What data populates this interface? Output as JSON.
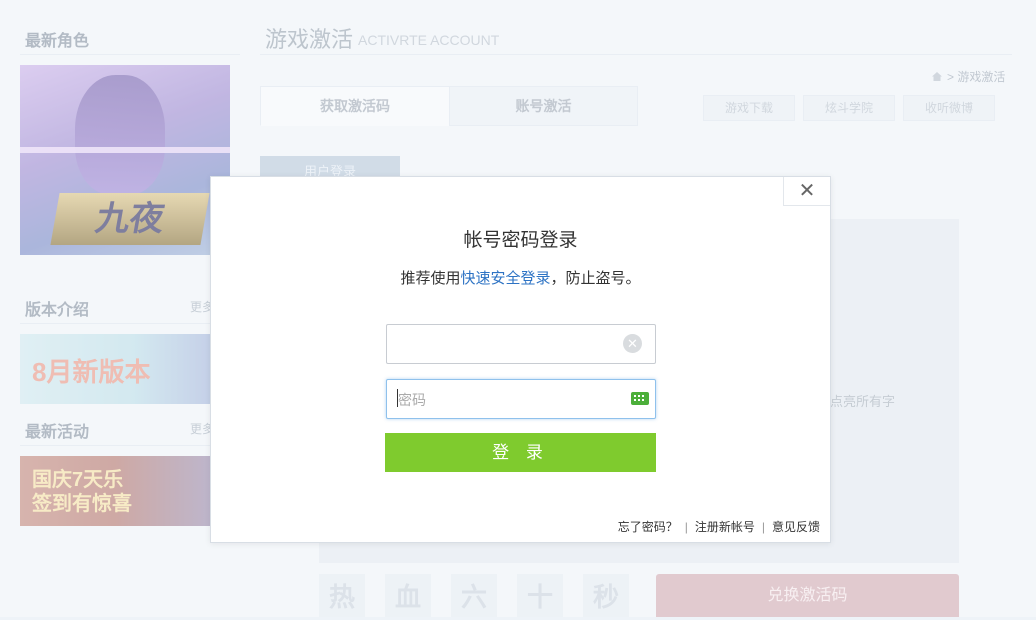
{
  "sidebar": {
    "section1": {
      "title": "最新角色"
    },
    "hero_logo_text": "九夜",
    "section2": {
      "title": "版本介绍",
      "more": "更多"
    },
    "banner1_text": "8月新版本",
    "section3": {
      "title": "最新活动",
      "more": "更多"
    },
    "banner2_text": "国庆7天乐\n签到有惊喜"
  },
  "header": {
    "title": "游戏激活",
    "subtitle": "ACTIVRTE ACCOUNT",
    "breadcrumb": {
      "separator": ">",
      "current": "游戏激活"
    }
  },
  "tabs": [
    {
      "label": "获取激活码"
    },
    {
      "label": "账号激活"
    }
  ],
  "shortcuts": [
    {
      "label": "游戏下载"
    },
    {
      "label": "炫斗学院"
    },
    {
      "label": "收听微博"
    }
  ],
  "user_login_label": "用户登录",
  "panel_text": "点亮所有字",
  "chars": [
    "热",
    "血",
    "六",
    "十",
    "秒"
  ],
  "redeem_button": "兑换激活码",
  "modal": {
    "close_glyph": "✕",
    "title": "帐号密码登录",
    "hint_prefix": "推荐使用",
    "hint_link": "快速安全登录",
    "hint_suffix": "，防止盗号。",
    "username": {
      "value": "",
      "placeholder": ""
    },
    "password": {
      "value": "",
      "placeholder": "密码"
    },
    "login_button": "登 录",
    "footer": {
      "forgot": "忘了密码？",
      "register": "注册新帐号",
      "feedback": "意见反馈",
      "separator": "|"
    }
  },
  "colors": {
    "login_button": "#7fcb2e",
    "link": "#2d73c4",
    "redeem_button": "#d2aeb6",
    "keyboard_icon": "#4caf3a"
  },
  "icons": {
    "close": "close-icon",
    "clear": "clear-input-icon",
    "keyboard": "keyboard-icon",
    "home": "home-icon"
  }
}
